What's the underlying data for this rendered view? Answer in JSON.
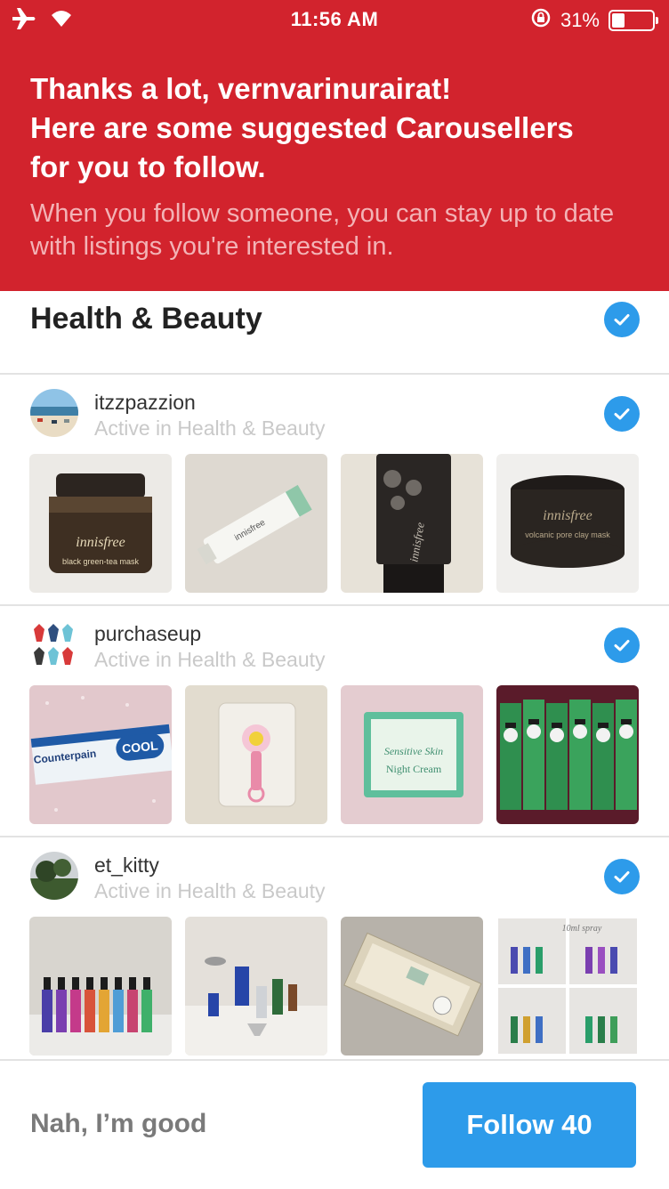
{
  "status_bar": {
    "time": "11:56 AM",
    "battery": "31%",
    "battery_level": 0.31,
    "icons": [
      "airplane-icon",
      "wifi-icon",
      "rotation-lock-icon",
      "battery-icon"
    ]
  },
  "header": {
    "title": "Thanks a lot, vernvarinurairat!\nHere are some suggested Carousellers\nfor you to follow.",
    "subtitle": "When you follow someone, you can stay up to date with listings you're interested in."
  },
  "category": {
    "title": "Health & Beauty",
    "selected": true
  },
  "users": [
    {
      "username": "itzzpazzion",
      "activity": "Active in Health & Beauty",
      "selected": true,
      "listings": [
        "innisfree black green-tea mask",
        "innisfree bija trouble balm",
        "innisfree super volcanic peel-off mask 2X",
        "innisfree super volcanic pore clay mask 2X"
      ]
    },
    {
      "username": "purchaseup",
      "activity": "Active in Health & Beauty",
      "selected": true,
      "listings": [
        "Counterpain COOL",
        "pink nail clipper",
        "Sensitive Skin Night Cream",
        "DARLIE toothpaste boxes"
      ]
    },
    {
      "username": "et_kitty",
      "activity": "Active in Health & Beauty",
      "selected": true,
      "listings": [
        "colorful spray bottles",
        "perfume bottles and funnels",
        "boxed item",
        "10ml spray"
      ]
    }
  ],
  "footer": {
    "decline_label": "Nah, I’m good",
    "follow_label": "Follow 40"
  },
  "colors": {
    "header_bg": "#d2232d",
    "accent_blue": "#2d9bea",
    "muted_text": "#c9c9c9"
  }
}
